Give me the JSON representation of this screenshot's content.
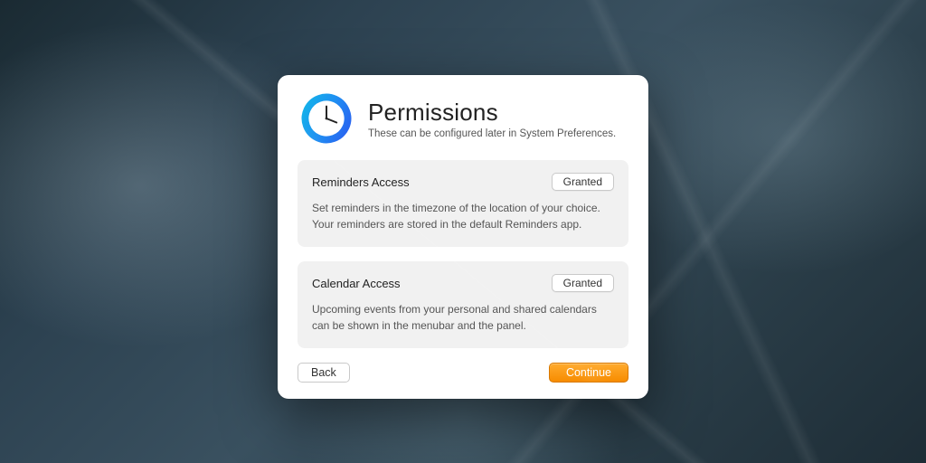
{
  "header": {
    "title": "Permissions",
    "subtitle": "These can be configured later in System Preferences."
  },
  "cards": [
    {
      "title": "Reminders Access",
      "status": "Granted",
      "description": "Set reminders in the timezone of the location of your choice. Your reminders are stored in the default Reminders app."
    },
    {
      "title": "Calendar Access",
      "status": "Granted",
      "description": "Upcoming events from your personal and shared calendars can be shown in the menubar and the panel."
    }
  ],
  "footer": {
    "back_label": "Back",
    "continue_label": "Continue"
  }
}
